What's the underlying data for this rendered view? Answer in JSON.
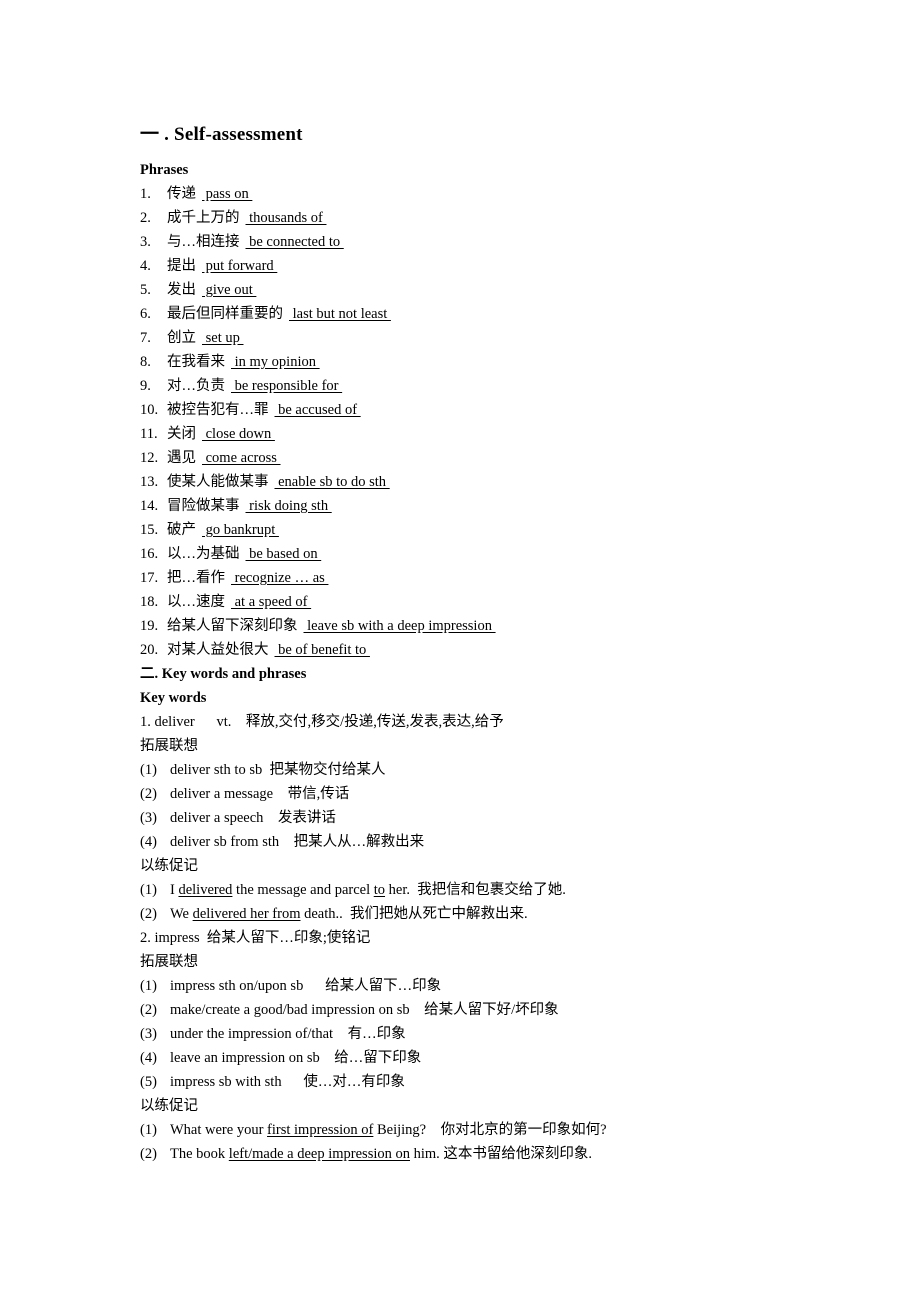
{
  "document": {
    "title": "一 . Self-assessment",
    "phrases_heading": "Phrases",
    "phrases": [
      {
        "num": "1.",
        "cn": "传递",
        "en": "pass on"
      },
      {
        "num": "2.",
        "cn": "成千上万的",
        "en": "thousands of"
      },
      {
        "num": "3.",
        "cn": "与…相连接",
        "en": "be connected to"
      },
      {
        "num": "4.",
        "cn": "提出",
        "en": "put forward"
      },
      {
        "num": "5.",
        "cn": "发出",
        "en": "give out"
      },
      {
        "num": "6.",
        "cn": "最后但同样重要的",
        "en": "last but not least"
      },
      {
        "num": "7.",
        "cn": "创立",
        "en": "set up"
      },
      {
        "num": "8.",
        "cn": "在我看来",
        "en": "in my opinion"
      },
      {
        "num": "9.",
        "cn": "对…负责",
        "en": "be responsible for"
      },
      {
        "num": "10.",
        "cn": "被控告犯有…罪",
        "en": "be accused of"
      },
      {
        "num": "11.",
        "cn": "关闭",
        "en": "close down"
      },
      {
        "num": "12.",
        "cn": "遇见",
        "en": "come across"
      },
      {
        "num": "13.",
        "cn": "使某人能做某事",
        "en": "enable sb to do sth"
      },
      {
        "num": "14.",
        "cn": "冒险做某事",
        "en": "risk doing sth"
      },
      {
        "num": "15.",
        "cn": "破产",
        "en": "go bankrupt"
      },
      {
        "num": "16.",
        "cn": "以…为基础",
        "en": "be based on"
      },
      {
        "num": "17.",
        "cn": "把…看作",
        "en": "recognize … as"
      },
      {
        "num": "18.",
        "cn": "以…速度",
        "en": "at a speed of"
      },
      {
        "num": "19.",
        "cn": "给某人留下深刻印象",
        "en": "leave sb with a deep impression"
      },
      {
        "num": "20.",
        "cn": "对某人益处很大",
        "en": "be of benefit to"
      }
    ],
    "section2_heading": "二. Key words and phrases",
    "key_words_heading": "Key words",
    "entries": [
      {
        "headword_line": "1. deliver      vt.    释放,交付,移交/投递,传送,发表,表达,给予",
        "expansion_label": "拓展联想",
        "expansions": [
          {
            "mark": "(1)",
            "text": "deliver sth to sb  把某物交付给某人"
          },
          {
            "mark": "(2)",
            "text": "deliver a message    带信,传话"
          },
          {
            "mark": "(3)",
            "text": "deliver a speech    发表讲话"
          },
          {
            "mark": "(4)",
            "text": "deliver sb from sth    把某人从…解救出来"
          }
        ],
        "practice_label": "以练促记",
        "practice": [
          {
            "mark": "(1)",
            "pre": "I ",
            "underline": "delivered",
            "mid": " the message and parcel ",
            "underline2": "to",
            "post": " her.  我把信和包裹交给了她."
          },
          {
            "mark": "(2)",
            "pre": "We ",
            "underline": "delivered her from",
            "mid": "",
            "underline2": "",
            "post": " death..  我们把她从死亡中解救出来."
          }
        ]
      },
      {
        "headword_line": "2. impress  给某人留下…印象;使铭记",
        "expansion_label": "拓展联想",
        "expansions": [
          {
            "mark": "(1)",
            "text": "impress sth on/upon sb      给某人留下…印象"
          },
          {
            "mark": "(2)",
            "text": "make/create a good/bad impression on sb    给某人留下好/坏印象"
          },
          {
            "mark": "(3)",
            "text": "under the impression of/that    有…印象"
          },
          {
            "mark": "(4)",
            "text": "leave an impression on sb    给…留下印象"
          },
          {
            "mark": "(5)",
            "text": "impress sb with sth      使…对…有印象"
          }
        ],
        "practice_label": "以练促记",
        "practice": [
          {
            "mark": "(1)",
            "pre": "What were your ",
            "underline": "first impression of",
            "mid": "",
            "underline2": "",
            "post": " Beijing?    你对北京的第一印象如何?"
          },
          {
            "mark": "(2)",
            "pre": "The book ",
            "underline": "left/made a deep impression on",
            "mid": "",
            "underline2": "",
            "post": " him. 这本书留给他深刻印象."
          }
        ]
      }
    ]
  }
}
